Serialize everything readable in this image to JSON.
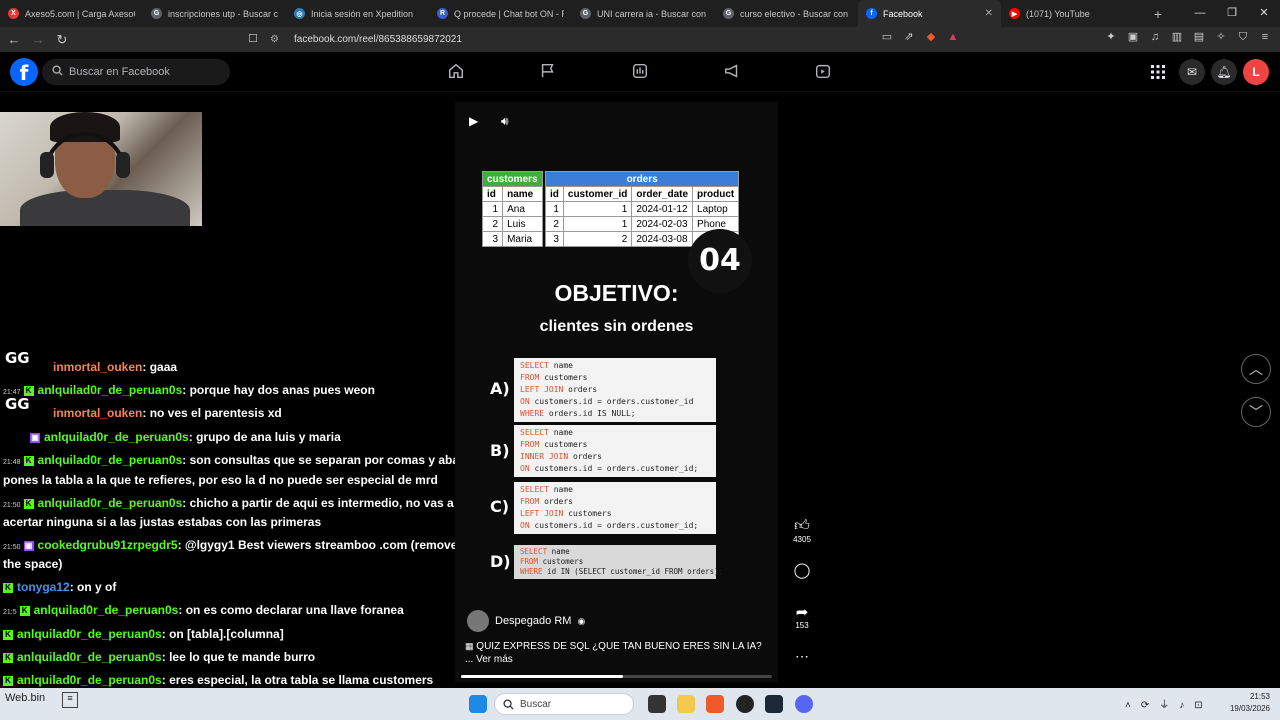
{
  "tabs": [
    {
      "title": "Axeso5.com | Carga AxesoCash",
      "icon": "axeso-icon",
      "color": "#e53935",
      "glyph": "X"
    },
    {
      "title": "inscripciones utp - Buscar con G",
      "icon": "google-icon",
      "color": "#5f6368",
      "glyph": "G"
    },
    {
      "title": "Inicia sesión en Xpedition",
      "icon": "xpedition-icon",
      "color": "#2b7bb9",
      "glyph": "◎"
    },
    {
      "title": "Q procede | Chat bot ON - Re",
      "icon": "chatbot-icon",
      "color": "#3b5bdb",
      "glyph": "R"
    },
    {
      "title": "UNI carrera ia - Buscar con Go",
      "icon": "google-icon",
      "color": "#5f6368",
      "glyph": "G"
    },
    {
      "title": "curso electivo - Buscar con Go",
      "icon": "google-icon",
      "color": "#5f6368",
      "glyph": "G"
    },
    {
      "title": "Facebook",
      "icon": "facebook-icon",
      "color": "#0866ff",
      "glyph": "f",
      "active": true
    },
    {
      "title": "(1071) YouTube",
      "icon": "youtube-icon",
      "color": "#ff0000",
      "glyph": "▶"
    }
  ],
  "url": "facebook.com/reel/865388659872021",
  "fb": {
    "logo": "f",
    "search_placeholder": "Buscar en Facebook",
    "avatar_letter": "L"
  },
  "chat": [
    {
      "time": "",
      "user": "inmortal_ouken",
      "text": ": gaaa",
      "color": "#ff7f50",
      "badge": "gg"
    },
    {
      "time": "21:47",
      "user": "anlquilad0r_de_peruan0s",
      "text": ": porque hay dos anas pues weon",
      "color": "#53fc18",
      "badge": "k"
    },
    {
      "time": "",
      "user": "inmortal_ouken",
      "text": ": no ves el parentesis xd",
      "color": "#ff7f50",
      "badge": "gg"
    },
    {
      "time": "",
      "user": "anlquilad0r_de_peruan0s",
      "text": ": grupo de ana luis y maria",
      "color": "#53fc18",
      "badge": "twitch"
    },
    {
      "time": "21:48",
      "user": "anlquilad0r_de_peruan0s",
      "text": ": son consultas que se separan por comas y abajo",
      "color": "#53fc18",
      "badge": "k"
    },
    {
      "time": "",
      "user": "",
      "text": "pones la tabla a la que te refieres, por eso la d no puede ser especial de mrd",
      "color": "#fff",
      "badge": ""
    },
    {
      "time": "21:50",
      "user": "anlquilad0r_de_peruan0s",
      "text": ": chicho a partir de aqui es intermedio, no vas a",
      "color": "#53fc18",
      "badge": "k"
    },
    {
      "time": "",
      "user": "",
      "text": "acertar ninguna si a las justas estabas con las primeras",
      "color": "#fff",
      "badge": ""
    },
    {
      "time": "21:50",
      "user": "cookedgrubu91zrpegdr5",
      "text": ": @lgygy1 Best viewers streamboo .com (remove",
      "color": "#53fc18",
      "badge": "tv",
      "mention": true
    },
    {
      "time": "",
      "user": "",
      "text": "the space)",
      "color": "#fff",
      "badge": ""
    },
    {
      "time": "",
      "user": "tonyga12",
      "text": ": on y of",
      "color": "#4a90e2",
      "badge": "k"
    },
    {
      "time": "21:5",
      "user": "anlquilad0r_de_peruan0s",
      "text": ": on es como declarar una llave foranea",
      "color": "#53fc18",
      "badge": "k"
    },
    {
      "time": "",
      "user": "anlquilad0r_de_peruan0s",
      "text": ": on [tabla].[columna]",
      "color": "#53fc18",
      "badge": "k"
    },
    {
      "time": "",
      "user": "anlquilad0r_de_peruan0s",
      "text": ": lee lo que te mande burro",
      "color": "#53fc18",
      "badge": "k"
    },
    {
      "time": "",
      "user": "anlquilad0r_de_peruan0s",
      "text": ": eres especial, la otra tabla se llama customers",
      "color": "#53fc18",
      "badge": "k"
    }
  ],
  "reel": {
    "customers_header": "customers",
    "orders_header": "orders",
    "customers_cols": [
      "id",
      "name"
    ],
    "orders_cols": [
      "id",
      "customer_id",
      "order_date",
      "product"
    ],
    "customers_rows": [
      [
        "1",
        "Ana"
      ],
      [
        "2",
        "Luis"
      ],
      [
        "3",
        "Maria"
      ]
    ],
    "orders_rows": [
      [
        "1",
        "1",
        "2024-01-12",
        "Laptop"
      ],
      [
        "2",
        "1",
        "2024-02-03",
        "Phone"
      ],
      [
        "3",
        "2",
        "2024-03-08",
        ""
      ]
    ],
    "number_badge": "04",
    "objective_title": "OBJETIVO:",
    "objective_sub": "clientes sin ordenes",
    "options": [
      {
        "letter": "A)",
        "lines": [
          [
            "SELECT",
            " name"
          ],
          [
            "FROM",
            " customers"
          ],
          [
            "LEFT JOIN",
            " orders"
          ],
          [
            "ON",
            " customers.id = orders.customer_id"
          ],
          [
            "WHERE",
            " orders.id IS NULL;"
          ]
        ]
      },
      {
        "letter": "B)",
        "lines": [
          [
            "SELECT",
            " name"
          ],
          [
            "FROM",
            " customers"
          ],
          [
            "INNER JOIN",
            " orders"
          ],
          [
            "ON",
            " customers.id = orders.customer_id;"
          ]
        ]
      },
      {
        "letter": "C)",
        "lines": [
          [
            "SELECT",
            " name"
          ],
          [
            "FROM",
            " orders"
          ],
          [
            "LEFT JOIN",
            " customers"
          ],
          [
            "ON",
            " customers.id = orders.customer_id;"
          ]
        ]
      },
      {
        "letter": "D)",
        "lines": [
          [
            "SELECT",
            " name"
          ],
          [
            "FROM",
            " customers"
          ],
          [
            "WHERE",
            " id IN (SELECT customer_id FROM orders);"
          ]
        ]
      }
    ],
    "author": "Despegado RM",
    "caption": "QUIZ EXPRESS DE SQL ¿QUE TAN BUENO ERES SIN LA IA?",
    "more": "... Ver más",
    "progress": 0.52,
    "likes": "4305",
    "shares": "153"
  },
  "taskbar": {
    "search": "Buscar",
    "time": "21:53",
    "date": "19/03/2026"
  },
  "bottom_left_label": "Web.bin"
}
